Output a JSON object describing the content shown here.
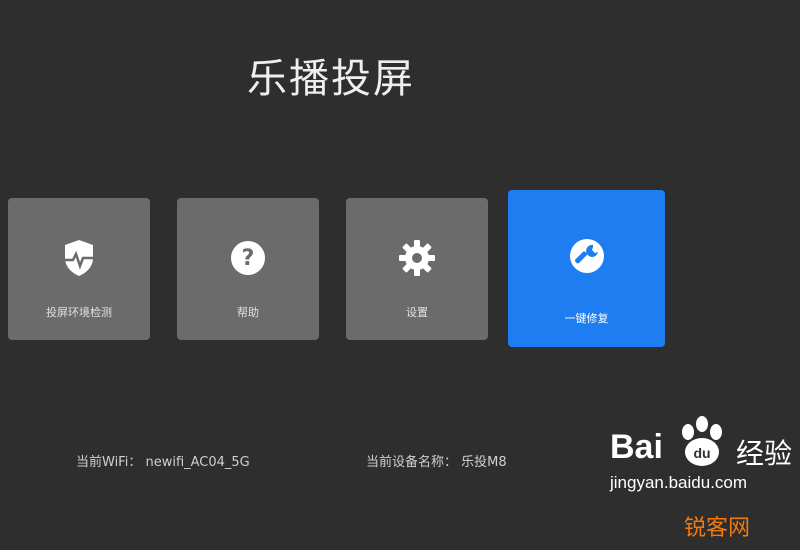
{
  "app": {
    "title": "乐播投屏"
  },
  "tiles": [
    {
      "label": "投屏环境检测",
      "icon": "shield-pulse-icon"
    },
    {
      "label": "帮助",
      "icon": "help-circle-icon"
    },
    {
      "label": "设置",
      "icon": "gear-icon"
    },
    {
      "label": "一键修复",
      "icon": "wrench-icon"
    }
  ],
  "status": {
    "wifi": "当前WiFi： newifi_AC04_5G",
    "device": "当前设备名称： 乐投M8"
  },
  "watermarks": {
    "baidu_word": "Bai",
    "baidu_cn": "经验",
    "baidu_url": "jingyan.baidu.com",
    "site": "锐客网"
  },
  "colors": {
    "background": "#2e2e2e",
    "tile": "#6b6b6b",
    "active_tile": "#1e7df0",
    "site_watermark": "#f07a10"
  }
}
